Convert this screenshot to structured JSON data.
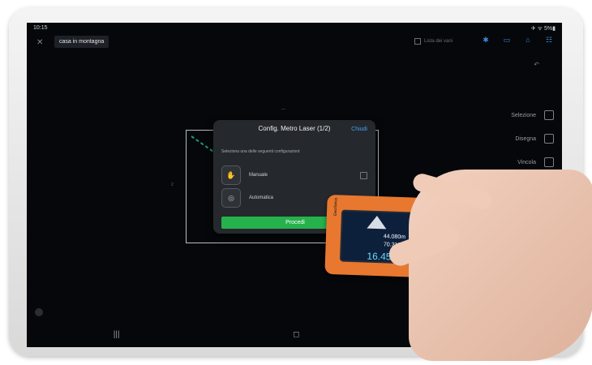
{
  "status_bar": {
    "time": "10:15",
    "right": "✈ ᯤ 5%▮"
  },
  "header": {
    "project_title": "casa in montagna",
    "list_label": "Lista dei vani"
  },
  "top_icons": [
    "bluetooth-icon",
    "layers-icon",
    "share-icon",
    "people-icon"
  ],
  "tools": [
    {
      "label": "Selezione",
      "icon": "select-icon"
    },
    {
      "label": "Disegna",
      "icon": "pencil-icon"
    },
    {
      "label": "Vincola",
      "icon": "link-icon"
    }
  ],
  "dialog": {
    "title": "Config. Metro Laser (1/2)",
    "close_label": "Chiudi",
    "subtitle": "Seleziona una delle seguenti configurazioni:",
    "options": [
      {
        "label": "Manuale",
        "icon": "hand-icon"
      },
      {
        "label": "Automatica",
        "icon": "auto-icon"
      }
    ],
    "proceed_label": "Procedi"
  },
  "device": {
    "brand": "GeoSwiss",
    "logo": "oeo",
    "readings": [
      "44.080m",
      "70.311m",
      "16.450m"
    ]
  },
  "nav": {
    "recent": "|||",
    "home": "◻",
    "back": "‹"
  },
  "colors": {
    "accent": "#3d87d9",
    "proceed": "#25b24c",
    "device": "#e8782f"
  }
}
